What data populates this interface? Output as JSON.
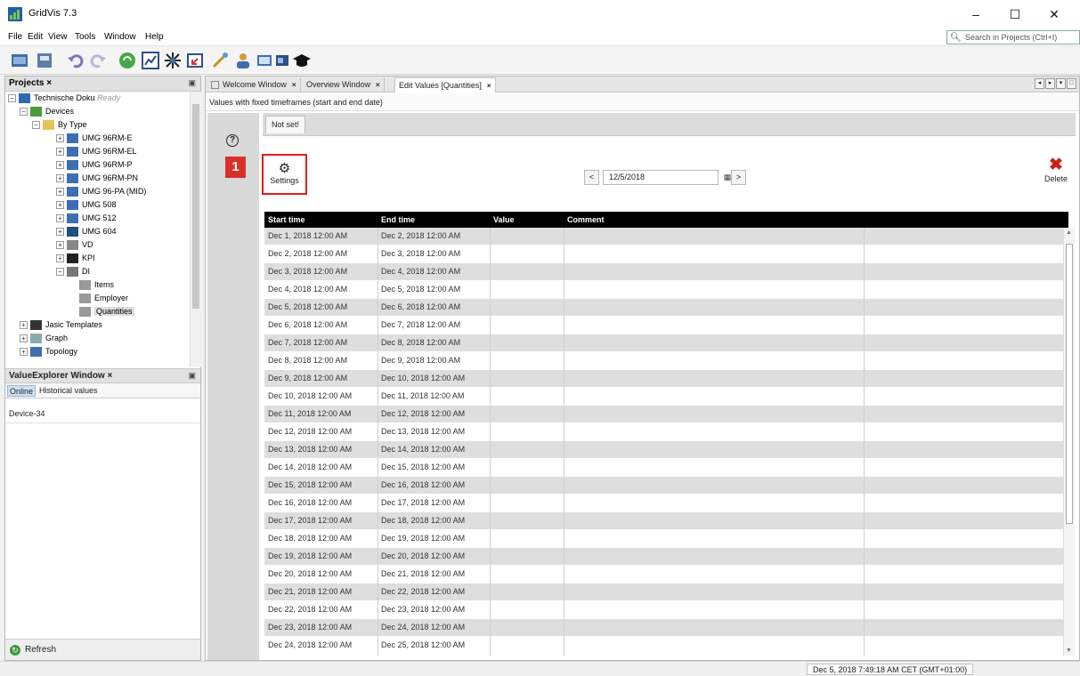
{
  "window": {
    "title": "GridVis 7.3",
    "minimize": "–",
    "maximize": "☐",
    "close": "✕"
  },
  "menu": [
    "File",
    "Edit",
    "View",
    "Tools",
    "Window",
    "Help"
  ],
  "search": {
    "placeholder": "Search in Projects (Ctrl+I)"
  },
  "projects_panel": {
    "title": "Projects",
    "close": "×",
    "tree": [
      {
        "label": "Technische Doku",
        "status": "Ready"
      },
      {
        "label": "Devices"
      },
      {
        "label": "By Type"
      },
      {
        "label": "UMG 96RM-E"
      },
      {
        "label": "UMG 96RM-EL"
      },
      {
        "label": "UMG 96RM-P"
      },
      {
        "label": "UMG 96RM-PN"
      },
      {
        "label": "UMG 96-PA (MID)"
      },
      {
        "label": "UMG 508"
      },
      {
        "label": "UMG 512"
      },
      {
        "label": "UMG 604"
      },
      {
        "label": "VD"
      },
      {
        "label": "KPI"
      },
      {
        "label": "DI"
      },
      {
        "label": "Items"
      },
      {
        "label": "Employer"
      },
      {
        "label": "Quantities"
      },
      {
        "label": "Jasic Templates"
      },
      {
        "label": "Graph"
      },
      {
        "label": "Topology"
      }
    ]
  },
  "value_explorer": {
    "title": "ValueExplorer Window",
    "close": "×",
    "tab_online": "Online",
    "tab_historical": "Historical values",
    "device": "Device-34",
    "refresh": "Refresh"
  },
  "editor": {
    "tabs": [
      {
        "label": "Welcome Window"
      },
      {
        "label": "Overview Window"
      },
      {
        "label": "Edit Values [Quantities]"
      }
    ],
    "tab_close": "×",
    "subtitle": "Values with fixed timeframes (start and end date)",
    "help": "?",
    "badge": "1",
    "notset_tab": "Not set!",
    "settings_label": "Settings",
    "date": "12/5/2018",
    "prev": "<",
    "next": ">",
    "delete_label": "Delete",
    "columns": [
      "Start time",
      "End time",
      "Value",
      "Comment"
    ],
    "rows": [
      [
        "Dec 1, 2018 12:00 AM",
        "Dec 2, 2018 12:00 AM"
      ],
      [
        "Dec 2, 2018 12:00 AM",
        "Dec 3, 2018 12:00 AM"
      ],
      [
        "Dec 3, 2018 12:00 AM",
        "Dec 4, 2018 12:00 AM"
      ],
      [
        "Dec 4, 2018 12:00 AM",
        "Dec 5, 2018 12:00 AM"
      ],
      [
        "Dec 5, 2018 12:00 AM",
        "Dec 6, 2018 12:00 AM"
      ],
      [
        "Dec 6, 2018 12:00 AM",
        "Dec 7, 2018 12:00 AM"
      ],
      [
        "Dec 7, 2018 12:00 AM",
        "Dec 8, 2018 12:00 AM"
      ],
      [
        "Dec 8, 2018 12:00 AM",
        "Dec 9, 2018 12:00 AM"
      ],
      [
        "Dec 9, 2018 12:00 AM",
        "Dec 10, 2018 12:00 AM"
      ],
      [
        "Dec 10, 2018 12:00 AM",
        "Dec 11, 2018 12:00 AM"
      ],
      [
        "Dec 11, 2018 12:00 AM",
        "Dec 12, 2018 12:00 AM"
      ],
      [
        "Dec 12, 2018 12:00 AM",
        "Dec 13, 2018 12:00 AM"
      ],
      [
        "Dec 13, 2018 12:00 AM",
        "Dec 14, 2018 12:00 AM"
      ],
      [
        "Dec 14, 2018 12:00 AM",
        "Dec 15, 2018 12:00 AM"
      ],
      [
        "Dec 15, 2018 12:00 AM",
        "Dec 16, 2018 12:00 AM"
      ],
      [
        "Dec 16, 2018 12:00 AM",
        "Dec 17, 2018 12:00 AM"
      ],
      [
        "Dec 17, 2018 12:00 AM",
        "Dec 18, 2018 12:00 AM"
      ],
      [
        "Dec 18, 2018 12:00 AM",
        "Dec 19, 2018 12:00 AM"
      ],
      [
        "Dec 19, 2018 12:00 AM",
        "Dec 20, 2018 12:00 AM"
      ],
      [
        "Dec 20, 2018 12:00 AM",
        "Dec 21, 2018 12:00 AM"
      ],
      [
        "Dec 21, 2018 12:00 AM",
        "Dec 22, 2018 12:00 AM"
      ],
      [
        "Dec 22, 2018 12:00 AM",
        "Dec 23, 2018 12:00 AM"
      ],
      [
        "Dec 23, 2018 12:00 AM",
        "Dec 24, 2018 12:00 AM"
      ],
      [
        "Dec 24, 2018 12:00 AM",
        "Dec 25, 2018 12:00 AM"
      ]
    ]
  },
  "status": {
    "text": "Dec 5, 2018 7:49:18 AM CET (GMT+01:00)"
  },
  "colors": {
    "accent_red": "#d9312a",
    "highlight_border": "#e01d1d",
    "header_black": "#000000",
    "alt_row": "#dedede"
  }
}
